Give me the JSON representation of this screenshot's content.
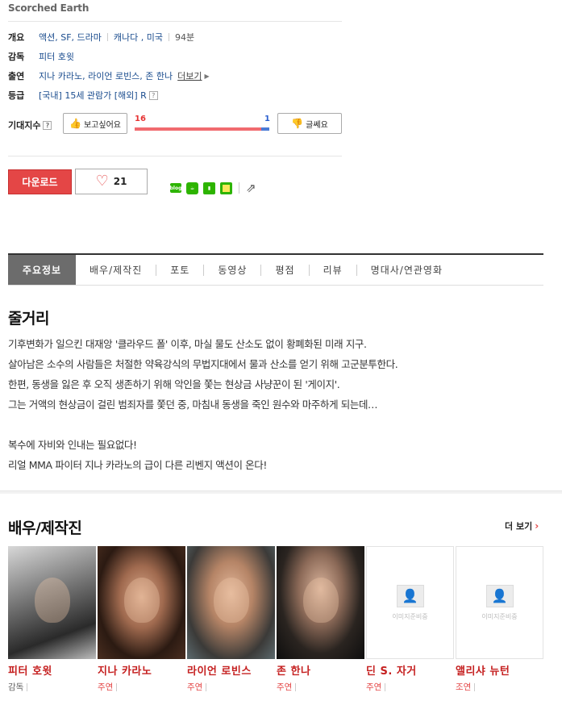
{
  "movie": {
    "original_title": "Scorched Earth"
  },
  "info": {
    "overview_label": "개요",
    "genres": "액션, SF, 드라마",
    "countries": "캐나다 , 미국",
    "runtime": "94분",
    "director_label": "감독",
    "director": "피터 호윗",
    "cast_label": "출연",
    "cast": "지나 카라노, 라이언 로빈스, 존 한나",
    "cast_more": "더보기",
    "rating_label": "등급",
    "rating": "[국내] 15세 관람가 [해외] R"
  },
  "expect": {
    "label": "기대지수",
    "want_label": "보고싶어요",
    "dont_label": "글쎄요",
    "want_count": "16",
    "dont_count": "1",
    "want_ratio": 0.94
  },
  "actions": {
    "download_label": "다운로드",
    "like_count": "21"
  },
  "tabs": [
    {
      "label": "주요정보"
    },
    {
      "label": "배우/제작진"
    },
    {
      "label": "포토"
    },
    {
      "label": "동영상"
    },
    {
      "label": "평점"
    },
    {
      "label": "리뷰"
    },
    {
      "label": "명대사/연관영화"
    }
  ],
  "synopsis": {
    "title": "줄거리",
    "lines": [
      "기후변화가 일으킨 대재앙 '클라우드 폴' 이후, 마실 물도 산소도 없이 황폐화된 미래 지구.",
      " 살아남은 소수의 사람들은 처절한 약육강식의 무법지대에서 물과 산소를 얻기 위해 고군분투한다.",
      " 한편, 동생을 잃은 후 오직 생존하기 위해 악인을 쫓는 현상금 사냥꾼이 된 '게이지'.",
      " 그는 거액의 현상금이 걸린 범죄자를 쫓던 중, 마침내 동생을 죽인 원수와 마주하게 되는데…",
      "",
      " 복수에 자비와 인내는 필요없다!",
      " 리얼 MMA 파이터 지나 카라노의 급이 다른 리벤지 액션이 온다!"
    ]
  },
  "cast_section": {
    "title": "배우/제작진",
    "more_label": "더 보기",
    "placeholder_text": "이미지준비중",
    "people": [
      {
        "name": "피터 호윗",
        "role": "감독"
      },
      {
        "name": "지나 카라노",
        "role": "주연"
      },
      {
        "name": "라이언 로빈스",
        "role": "주연"
      },
      {
        "name": "존 한나",
        "role": "주연"
      },
      {
        "name": "딘 S. 자거",
        "role": "주연"
      },
      {
        "name": "앨리샤 뉴턴",
        "role": "조연"
      }
    ]
  }
}
